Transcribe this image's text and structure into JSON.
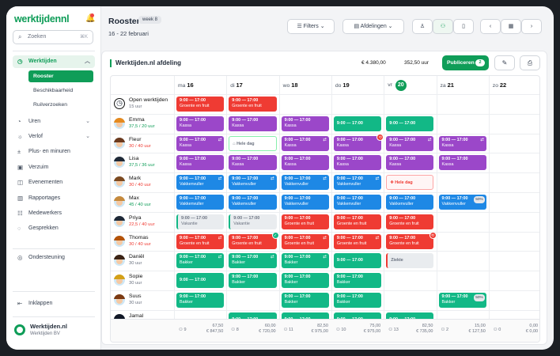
{
  "app": {
    "logo": "werktijdennl"
  },
  "search": {
    "placeholder": "Zoeken",
    "shortcut": "⌘K"
  },
  "nav": {
    "werktijden": "Werktijden",
    "sub": [
      "Rooster",
      "Beschikbaarheid",
      "Ruilverzoeken"
    ],
    "items": [
      "Uren",
      "Verlof",
      "Plus- en minuren",
      "Verzuim",
      "Evenementen",
      "Rapportages",
      "Medewerkers",
      "Gesprekken"
    ],
    "support": "Ondersteuning",
    "collapse": "Inklappen"
  },
  "company": {
    "name": "Werktijden.nl",
    "sub": "Werktijden BV"
  },
  "header": {
    "title": "Rooster",
    "week": "week 8",
    "range": "16 - 22 februari",
    "filters": "Filters",
    "departments": "Afdelingen"
  },
  "toolbar": {
    "title": "Werktijden.nl afdeling",
    "cost": "€ 4.380,00",
    "hours": "352,50 uur",
    "publish": "Publiceren",
    "publish_count": "2"
  },
  "days": [
    {
      "d": "ma",
      "n": "16"
    },
    {
      "d": "di",
      "n": "17"
    },
    {
      "d": "wo",
      "n": "18"
    },
    {
      "d": "do",
      "n": "19"
    },
    {
      "d": "vr",
      "n": "20",
      "today": true
    },
    {
      "d": "za",
      "n": "21"
    },
    {
      "d": "zo",
      "n": "22"
    }
  ],
  "employees": [
    {
      "name": "Open werktijden",
      "hours": "15 uur",
      "hc": "#6b7280",
      "open": true
    },
    {
      "name": "Emma",
      "hours": "37,5 / 20 uur",
      "hc": "#0f9d58",
      "hair": "#e58a1f"
    },
    {
      "name": "Fleur",
      "hours": "30 / 40 uur",
      "hc": "#ef3b33",
      "hair": "#6b3a1e"
    },
    {
      "name": "Lisa",
      "hours": "37,5 / 36 uur",
      "hc": "#0f9d58",
      "hair": "#1f2937"
    },
    {
      "name": "Mark",
      "hours": "30 / 40 uur",
      "hc": "#ef3b33",
      "hair": "#7c4a21"
    },
    {
      "name": "Max",
      "hours": "45 / 40 uur",
      "hc": "#0f9d58",
      "hair": "#c68a3d"
    },
    {
      "name": "Priya",
      "hours": "22,5 / 40 uur",
      "hc": "#ef3b33",
      "hair": "#1f2937"
    },
    {
      "name": "Thomas",
      "hours": "30 / 40 uur",
      "hc": "#ef3b33",
      "hair": "#b45309"
    },
    {
      "name": "Daniël",
      "hours": "30 uur",
      "hc": "#6b7280",
      "hair": "#3b2314"
    },
    {
      "name": "Sopie",
      "hours": "30 uur",
      "hc": "#6b7280",
      "hair": "#d4a017"
    },
    {
      "name": "Suus",
      "hours": "30 uur",
      "hc": "#6b7280",
      "hair": "#7c3a12"
    },
    {
      "name": "Jamal",
      "hours": "",
      "hc": "#6b7280",
      "hair": "#111827"
    }
  ],
  "shifts": [
    {
      "r": 0,
      "c": 0,
      "time": "9:00 — 17:00",
      "role": "Groente en fruit",
      "color": "red"
    },
    {
      "r": 0,
      "c": 1,
      "time": "9:00 — 17:00",
      "role": "Groente en fruit",
      "color": "red"
    },
    {
      "r": 1,
      "c": 0,
      "time": "9:00 — 17:00",
      "role": "Kassa",
      "color": "purple"
    },
    {
      "r": 1,
      "c": 1,
      "time": "9:00 — 17:00",
      "role": "Kassa",
      "color": "purple"
    },
    {
      "r": 1,
      "c": 2,
      "time": "9:00 — 17:00",
      "role": "Kassa",
      "color": "purple"
    },
    {
      "r": 1,
      "c": 3,
      "time": "9:00 — 17:00",
      "role": "",
      "color": "green striped"
    },
    {
      "r": 1,
      "c": 4,
      "time": "9:00 — 17:00",
      "role": "",
      "color": "green striped"
    },
    {
      "r": 2,
      "c": 0,
      "time": "9:00 — 17:00",
      "role": "Kassa",
      "color": "purple",
      "icon": "⇄"
    },
    {
      "r": 2,
      "c": 1,
      "time": "Hele dag",
      "role": "",
      "color": "note",
      "icon": "⌂"
    },
    {
      "r": 2,
      "c": 2,
      "time": "9:00 — 17:00",
      "role": "Kassa",
      "color": "purple",
      "icon": "⇄"
    },
    {
      "r": 2,
      "c": 3,
      "time": "9:00 — 17:00",
      "role": "Kassa",
      "color": "purple",
      "badge": "⟲"
    },
    {
      "r": 2,
      "c": 4,
      "time": "9:00 — 17:00",
      "role": "Kassa",
      "color": "purple",
      "icon": "⇄"
    },
    {
      "r": 2,
      "c": 5,
      "time": "9:00 — 17:00",
      "role": "Kassa",
      "color": "purple",
      "icon": "⇄"
    },
    {
      "r": 3,
      "c": 0,
      "time": "9:00 — 17:00",
      "role": "Kassa",
      "color": "purple"
    },
    {
      "r": 3,
      "c": 1,
      "time": "9:00 — 17:00",
      "role": "Kassa",
      "color": "purple"
    },
    {
      "r": 3,
      "c": 2,
      "time": "9:00 — 17:00",
      "role": "Kassa",
      "color": "purple"
    },
    {
      "r": 3,
      "c": 3,
      "time": "9:00 — 17:00",
      "role": "Kassa",
      "color": "purple"
    },
    {
      "r": 3,
      "c": 4,
      "time": "9:00 — 17:00",
      "role": "Kassa",
      "color": "purple"
    },
    {
      "r": 3,
      "c": 5,
      "time": "9:00 — 17:00",
      "role": "Kassa",
      "color": "purple"
    },
    {
      "r": 4,
      "c": 0,
      "time": "9:00 — 17:00",
      "role": "Vakkenvuller",
      "color": "blue",
      "icon": "⇄"
    },
    {
      "r": 4,
      "c": 1,
      "time": "9:00 — 17:00",
      "role": "Vakkenvuller",
      "color": "blue",
      "icon": "⇄"
    },
    {
      "r": 4,
      "c": 2,
      "time": "9:00 — 17:00",
      "role": "Vakkenvuller",
      "color": "blue",
      "icon": "⇄"
    },
    {
      "r": 4,
      "c": 3,
      "time": "9:00 — 17:00",
      "role": "Vakkenvuller",
      "color": "blue",
      "icon": "⇄"
    },
    {
      "r": 4,
      "c": 4,
      "time": "Hele dag",
      "role": "",
      "color": "note red",
      "icon": "✚"
    },
    {
      "r": 5,
      "c": 0,
      "time": "9:00 — 17:00",
      "role": "Vakkenvuller",
      "color": "blue"
    },
    {
      "r": 5,
      "c": 1,
      "time": "9:00 — 17:00",
      "role": "Vakkenvuller",
      "color": "blue"
    },
    {
      "r": 5,
      "c": 2,
      "time": "9:00 — 17:00",
      "role": "Vakkenvuller",
      "color": "blue"
    },
    {
      "r": 5,
      "c": 3,
      "time": "9:00 — 17:00",
      "role": "Vakkenvuller",
      "color": "blue"
    },
    {
      "r": 5,
      "c": 4,
      "time": "9:00 — 17:00",
      "role": "Vakkenvuller",
      "color": "blue"
    },
    {
      "r": 5,
      "c": 5,
      "time": "9:00 — 17:00",
      "role": "Vakkenvuller",
      "color": "blue",
      "pct": "50%"
    },
    {
      "r": 6,
      "c": 0,
      "time": "9:00 — 17:00",
      "role": "Vakantie",
      "color": "grey"
    },
    {
      "r": 6,
      "c": 1,
      "time": "9:00 — 17:00",
      "role": "Vakantie",
      "color": "grey"
    },
    {
      "r": 6,
      "c": 2,
      "time": "9:00 — 17:00",
      "role": "Groente en fruit",
      "color": "red"
    },
    {
      "r": 6,
      "c": 3,
      "time": "9:00 — 17:00",
      "role": "Groente en fruit",
      "color": "red"
    },
    {
      "r": 6,
      "c": 4,
      "time": "9:00 — 17:00",
      "role": "Groente en fruit",
      "color": "red"
    },
    {
      "r": 7,
      "c": 0,
      "time": "9:00 — 17:00",
      "role": "Groente en fruit",
      "color": "red",
      "icon": "⇄"
    },
    {
      "r": 7,
      "c": 1,
      "time": "9:00 — 17:00",
      "role": "Groente en fruit",
      "color": "red",
      "badge": "✓",
      "bg": true
    },
    {
      "r": 7,
      "c": 2,
      "time": "9:00 — 17:00",
      "role": "Groente en fruit",
      "color": "red",
      "icon": "⇄"
    },
    {
      "r": 7,
      "c": 3,
      "time": "9:00 — 17:00",
      "role": "Groente en fruit",
      "color": "red",
      "icon": "⇄"
    },
    {
      "r": 7,
      "c": 4,
      "time": "9:00 — 17:00",
      "role": "Groente en fruit",
      "color": "red",
      "badge": "⟲"
    },
    {
      "r": 8,
      "c": 0,
      "time": "9:00 — 17:00",
      "role": "Bakker",
      "color": "green",
      "icon": "⇄"
    },
    {
      "r": 8,
      "c": 1,
      "time": "9:00 — 17:00",
      "role": "Bakker",
      "color": "green",
      "icon": "⇄"
    },
    {
      "r": 8,
      "c": 2,
      "time": "9:00 — 17:00",
      "role": "Bakker",
      "color": "green",
      "icon": "⇄"
    },
    {
      "r": 8,
      "c": 3,
      "time": "9:00 — 17:00",
      "role": "",
      "color": "green"
    },
    {
      "r": 8,
      "c": 4,
      "time": "Ziekte",
      "role": "",
      "color": "grey redline single"
    },
    {
      "r": 9,
      "c": 0,
      "time": "9:00 — 17:00",
      "role": "",
      "color": "green"
    },
    {
      "r": 9,
      "c": 1,
      "time": "9:00 — 17:00",
      "role": "Bakker",
      "color": "green"
    },
    {
      "r": 9,
      "c": 2,
      "time": "9:00 — 17:00",
      "role": "Bakker",
      "color": "green"
    },
    {
      "r": 9,
      "c": 3,
      "time": "9:00 — 17:00",
      "role": "Bakker",
      "color": "green"
    },
    {
      "r": 10,
      "c": 0,
      "time": "9:00 — 17:00",
      "role": "Bakker",
      "color": "green"
    },
    {
      "r": 10,
      "c": 2,
      "time": "9:00 — 17:00",
      "role": "Bakker",
      "color": "green"
    },
    {
      "r": 10,
      "c": 3,
      "time": "9:00 — 17:00",
      "role": "Bakker",
      "color": "green"
    },
    {
      "r": 10,
      "c": 5,
      "time": "9:00 — 17:00",
      "role": "Bakker",
      "color": "green",
      "pct": "50%"
    },
    {
      "r": 11,
      "c": 1,
      "time": "9:00 — 17:00",
      "role": "",
      "color": "green"
    },
    {
      "r": 11,
      "c": 2,
      "time": "9:00 — 17:00",
      "role": "",
      "color": "green"
    },
    {
      "r": 11,
      "c": 3,
      "time": "9:00 — 17:00",
      "role": "",
      "color": "green"
    },
    {
      "r": 11,
      "c": 4,
      "time": "9:00 — 17:00",
      "role": "",
      "color": "green"
    }
  ],
  "footer": [
    {
      "people": "9",
      "hours": "67,50",
      "cost": "€ 847,50"
    },
    {
      "people": "8",
      "hours": "60,00",
      "cost": "€ 720,00"
    },
    {
      "people": "11",
      "hours": "82,50",
      "cost": "€ 975,00"
    },
    {
      "people": "10",
      "hours": "75,00",
      "cost": "€ 975,00"
    },
    {
      "people": "13",
      "hours": "82,50",
      "cost": "€ 735,00"
    },
    {
      "people": "2",
      "hours": "15,00",
      "cost": "€ 127,50"
    },
    {
      "people": "0",
      "hours": "0,00",
      "cost": "€ 0,00"
    }
  ],
  "colors": {
    "brand": "#0f9d58",
    "red": "#ef3b33",
    "purple": "#9b47c9",
    "blue": "#1e88e5",
    "green": "#12b886"
  }
}
